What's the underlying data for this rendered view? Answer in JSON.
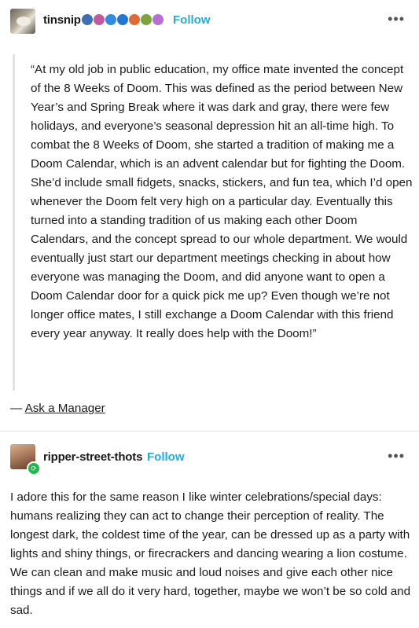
{
  "post1": {
    "username": "tinsnip",
    "follow_label": "Follow",
    "more_label": "•••",
    "badges": [
      {
        "name": "globe-badge-icon",
        "color": "#3e6fb5"
      },
      {
        "name": "flower-badge-icon",
        "color": "#c25aa0"
      },
      {
        "name": "verified-badge-icon",
        "color": "#2e8de0"
      },
      {
        "name": "verified-badge-icon",
        "color": "#1e78d4"
      },
      {
        "name": "flame-badge-icon",
        "color": "#e26a2c"
      },
      {
        "name": "leaf-badge-icon",
        "color": "#7da33b"
      },
      {
        "name": "swirl-badge-icon",
        "color": "#b76fd6"
      }
    ],
    "quote": "“At my old job in public education, my office mate invented the concept of the 8 Weeks of Doom. This was defined as the period between New Year’s and Spring Break where it was dark and gray, there were few holidays, and everyone’s seasonal depression hit an all-time high. To combat the 8 Weeks of Doom, she started a tradition of making me a Doom Calendar, which is an advent calendar but for fighting the Doom. She’d include small fidgets, snacks, stickers, and fun tea, which I’d open whenever the Doom felt very high on a particular day. Eventually this turned into a standing tradition of us making each other Doom Calendars, and the concept spread to our whole department. We would eventually just start our department meetings checking in about how everyone was managing the Doom, and did anyone want to open a Doom Calendar door for a quick pick me up? Even though we’re not longer office mates, I still exchange a Doom Calendar with this friend every year anyway. It really does help with the Doom!”",
    "attribution_dash": "— ",
    "attribution_link": "Ask a Manager"
  },
  "post2": {
    "username": "ripper-street-thots",
    "follow_label": "Follow",
    "more_label": "•••",
    "body": "I adore this for the same reason I like winter celebrations/special days: humans realizing they can act to change their perception of reality. The longest dark, the coldest time of the year, can be dressed up as a party with lights and shiny things, or firecrackers and dancing wearing a lion costume. We can clean and make music and loud noises and give each other nice things and if we all do it very hard, together, maybe we won’t be so cold and sad."
  }
}
